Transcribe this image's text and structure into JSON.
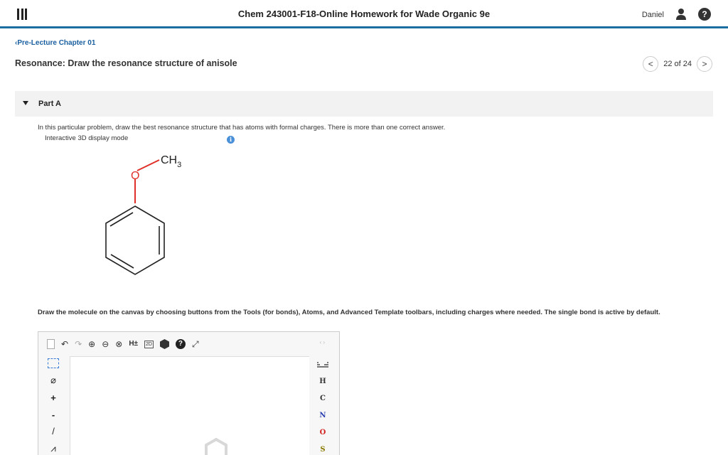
{
  "header": {
    "title": "Chem 243001-F18-Online Homework for Wade Organic 9e",
    "user_name": "Daniel",
    "help_symbol": "?"
  },
  "nav": {
    "back_label": "Pre-Lecture Chapter 01",
    "page_title": "Resonance: Draw the resonance structure of anisole",
    "position": "22 of 24",
    "prev_symbol": "<",
    "next_symbol": ">"
  },
  "part": {
    "label": "Part A",
    "instructions": "In this particular problem, draw the best resonance structure that has atoms with formal charges. There is more than one correct answer.",
    "display_mode": "Interactive 3D display mode",
    "info_symbol": "i"
  },
  "molecule": {
    "oxygen_label": "O",
    "methyl_label": "CH",
    "methyl_subscript": "3",
    "oxygen_color": "#e0302a"
  },
  "editor": {
    "draw_instructions": "Draw the molecule on the canvas by choosing buttons from the Tools (for bonds), Atoms, and Advanced Template toolbars, including charges where needed. The single bond is active by default.",
    "toolbar": {
      "undo": "↶",
      "redo": "↷",
      "zoom_in": "⊕",
      "zoom_out": "⊖",
      "zoom_reset": "⊗",
      "hydrogens": "H±",
      "clean_2d": "2D",
      "help": "?",
      "fullscreen": "⤢",
      "nav_arrows": "‹ ›"
    },
    "left_tools": {
      "erase": "⌀",
      "plus": "+",
      "minus": "-",
      "bond": "/",
      "chain": "⩘"
    },
    "atoms": [
      {
        "symbol": "H",
        "color": "#333333"
      },
      {
        "symbol": "C",
        "color": "#333333"
      },
      {
        "symbol": "N",
        "color": "#2a3fb0"
      },
      {
        "symbol": "O",
        "color": "#d02020"
      },
      {
        "symbol": "S",
        "color": "#8a7a00"
      }
    ]
  }
}
